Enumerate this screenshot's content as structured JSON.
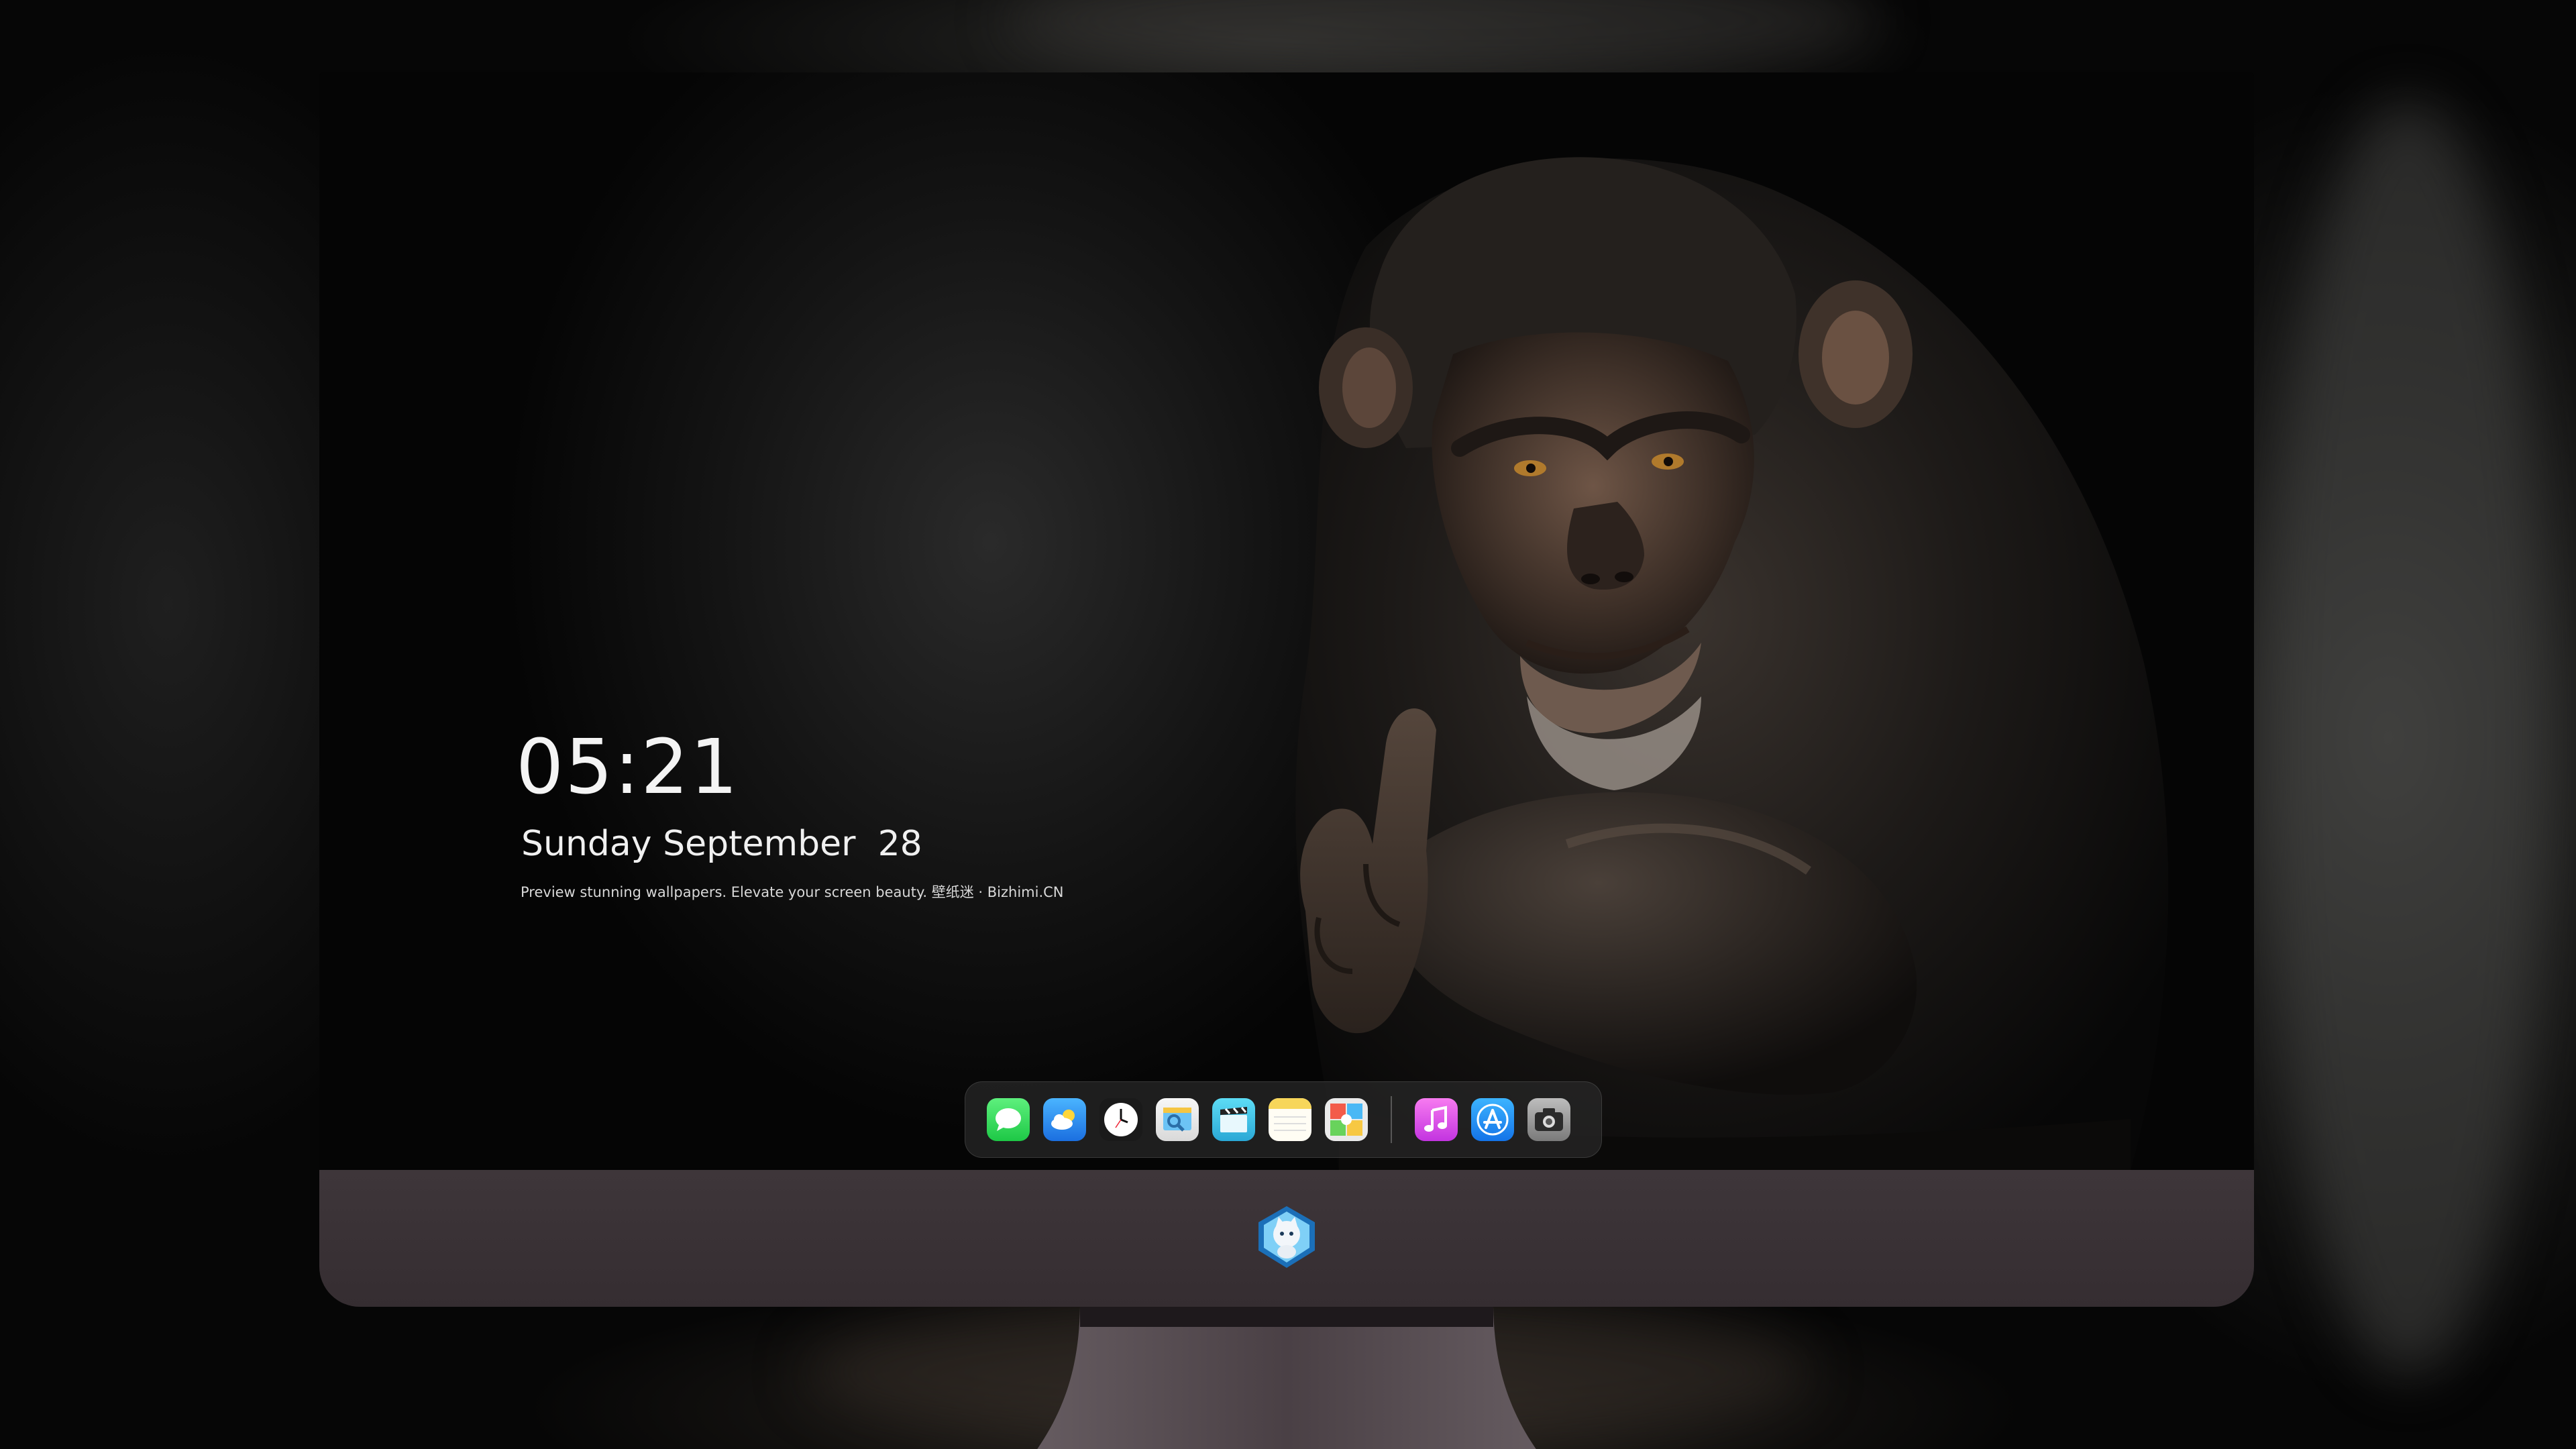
{
  "lock_screen": {
    "time": "05:21",
    "date": "Sunday September  28",
    "tagline": "Preview stunning wallpapers. Elevate your screen beauty. 壁纸迷 · Bizhimi.CN"
  },
  "dock": {
    "apps": [
      {
        "name": "messages-icon",
        "color": "#2fd157"
      },
      {
        "name": "weather-icon",
        "color": "#2b8ef0"
      },
      {
        "name": "clock-icon",
        "color": "#ffffff"
      },
      {
        "name": "preview-icon",
        "color": "#f5c542"
      },
      {
        "name": "claquette-icon",
        "color": "#36c6e8"
      },
      {
        "name": "notes-icon",
        "color": "#f7d65a"
      },
      {
        "name": "photo-booth-icon",
        "color": "#e8e8e8"
      }
    ],
    "apps_right": [
      {
        "name": "music-icon",
        "color": "#e23cd0"
      },
      {
        "name": "app-store-icon",
        "color": "#1e8ef7"
      },
      {
        "name": "screenshot-icon",
        "color": "#8a8a8a"
      }
    ]
  },
  "colors": {
    "monitor_chin": "#3a3236",
    "stand": "#3d3539",
    "text": "#f4f4f4"
  }
}
